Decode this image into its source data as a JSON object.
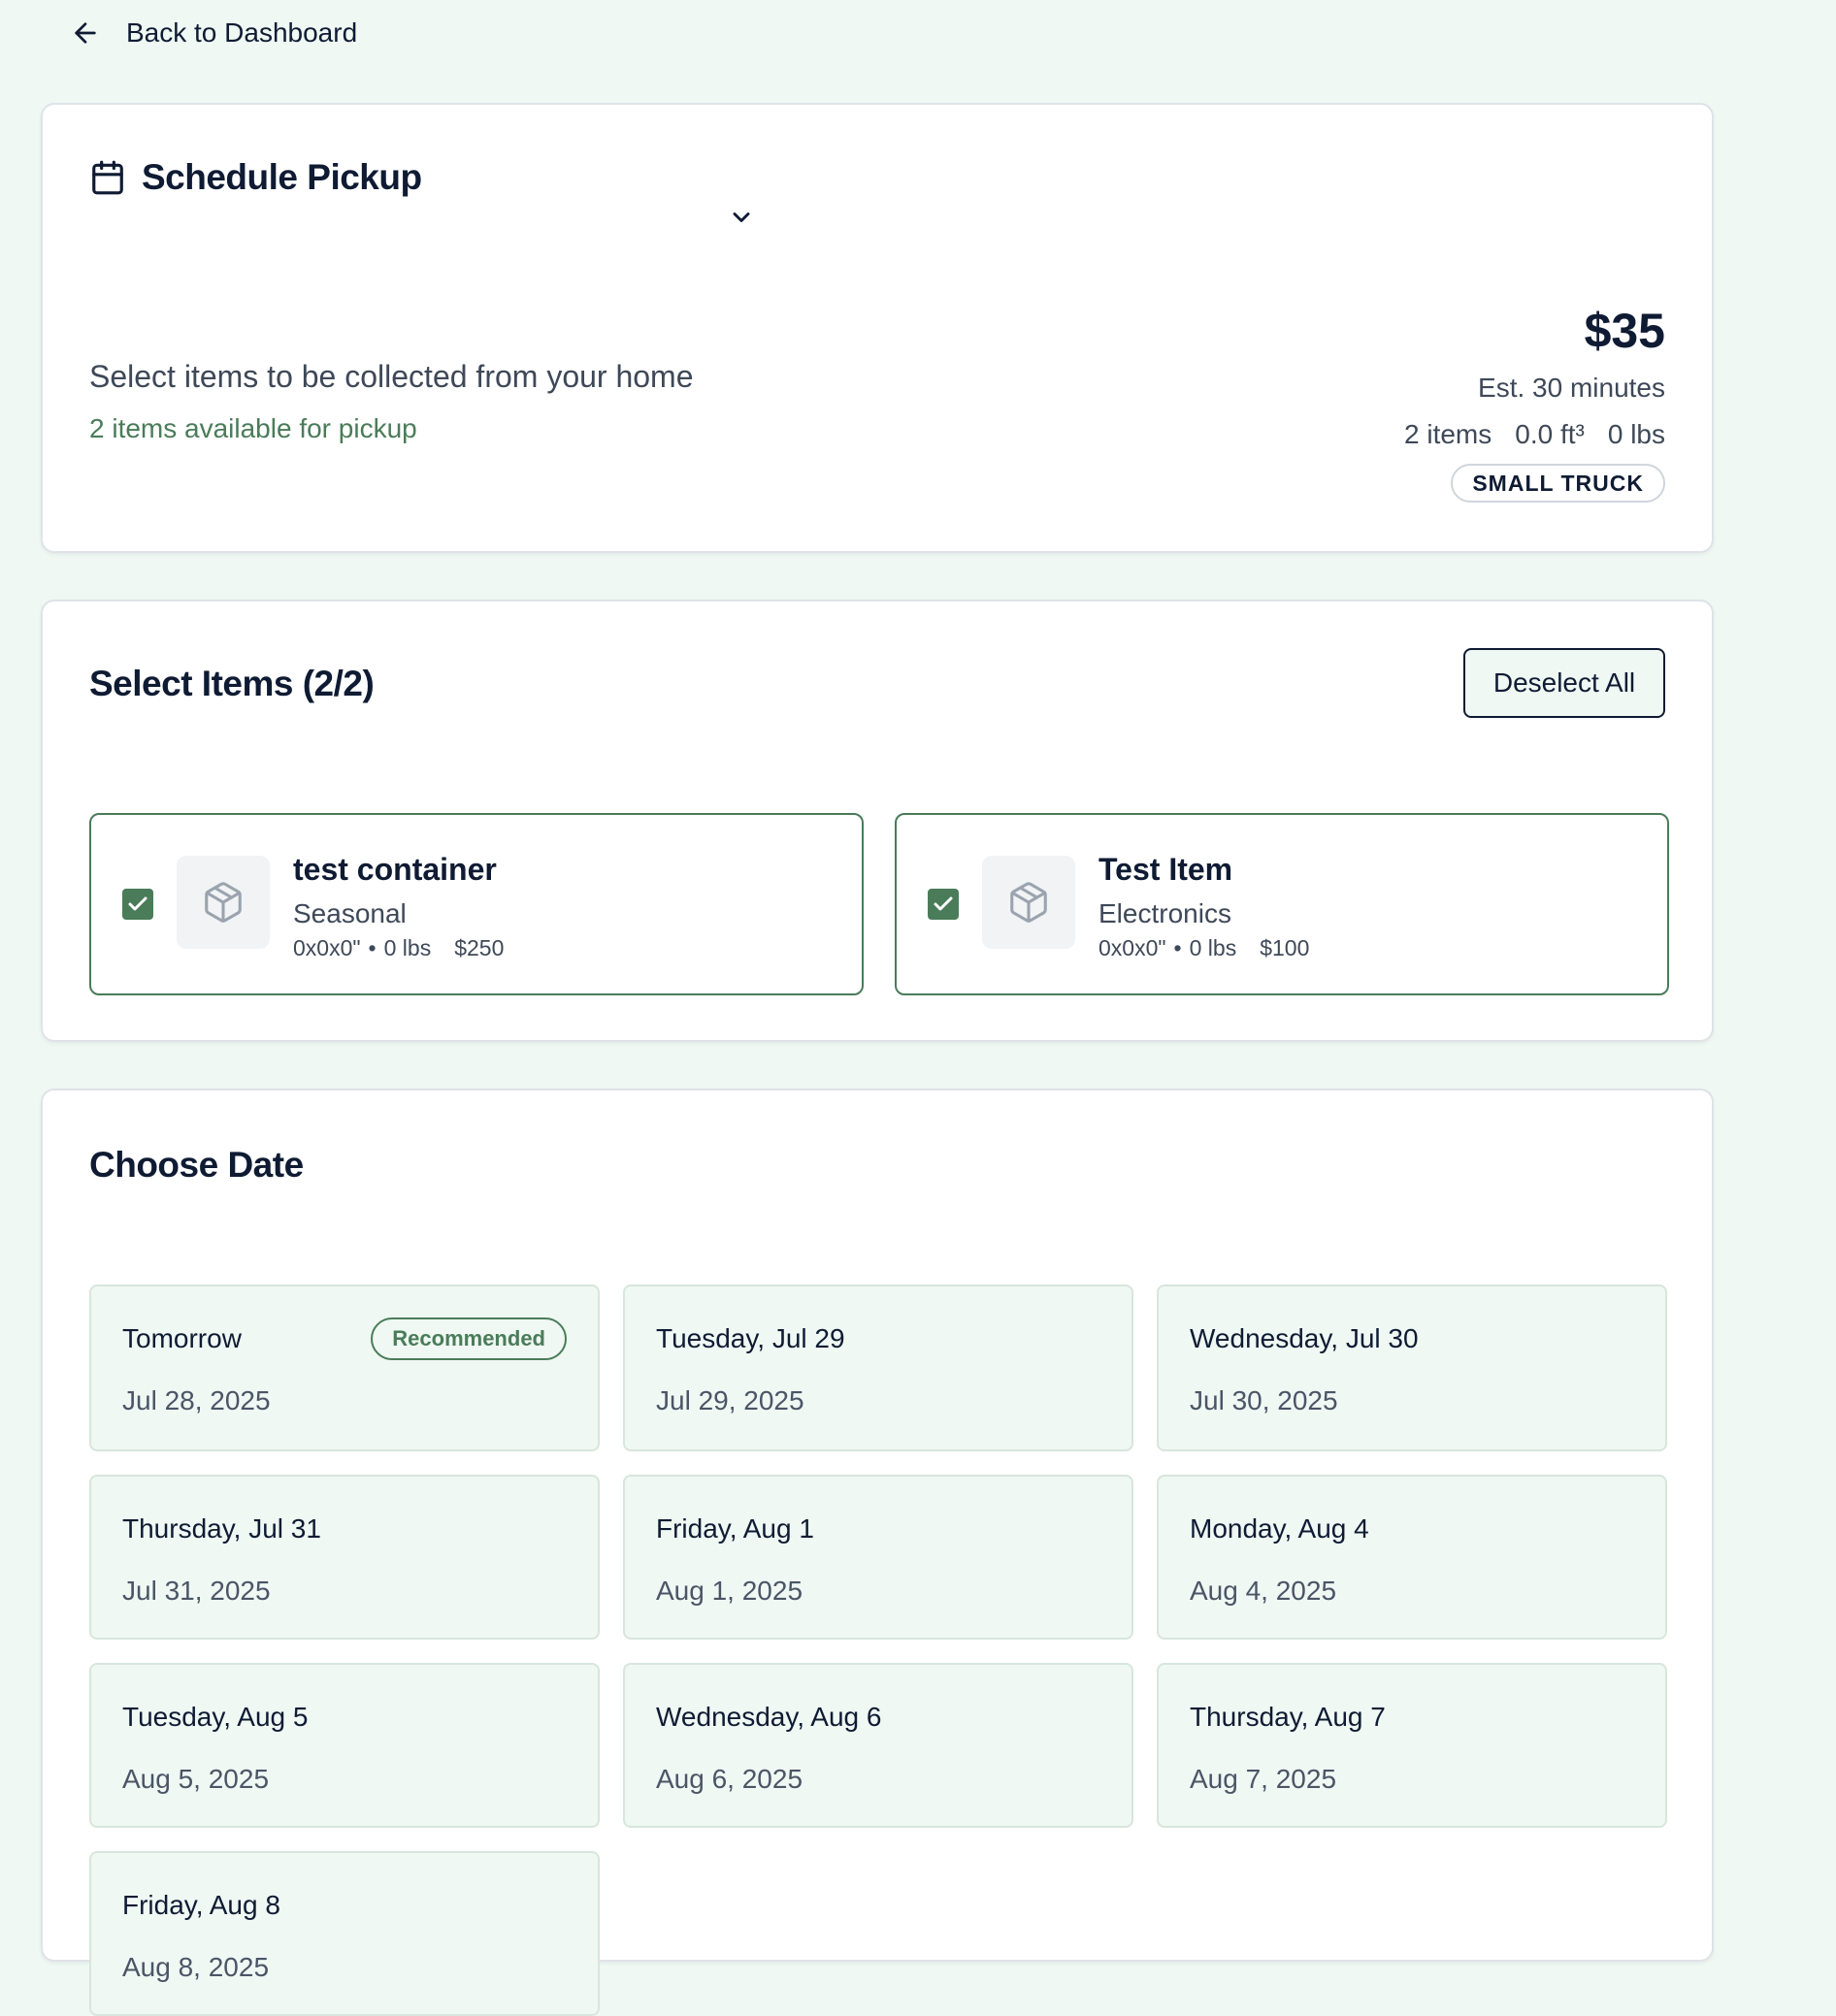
{
  "back": {
    "label": "Back to Dashboard"
  },
  "schedule": {
    "title": "Schedule Pickup",
    "description": "Select items to be collected from your home",
    "available": "2 items available for pickup",
    "price": "$35",
    "estimate": "Est. 30 minutes",
    "stats": {
      "items": "2 items",
      "volume": "0.0 ft³",
      "weight": "0 lbs"
    },
    "vehicle": "SMALL TRUCK"
  },
  "items_section": {
    "title": "Select Items (2/2)",
    "deselect_label": "Deselect All",
    "items": [
      {
        "name": "test container",
        "category": "Seasonal",
        "dimensions": "0x0x0\"",
        "separator": "•",
        "weight": "0 lbs",
        "value": "$250",
        "checked": true
      },
      {
        "name": "Test Item",
        "category": "Electronics",
        "dimensions": "0x0x0\"",
        "separator": "•",
        "weight": "0 lbs",
        "value": "$100",
        "checked": true
      }
    ]
  },
  "dates_section": {
    "title": "Choose Date",
    "recommended_label": "Recommended",
    "dates": [
      {
        "day": "Tomorrow",
        "date": "Jul 28, 2025",
        "recommended": true
      },
      {
        "day": "Tuesday, Jul 29",
        "date": "Jul 29, 2025"
      },
      {
        "day": "Wednesday, Jul 30",
        "date": "Jul 30, 2025"
      },
      {
        "day": "Thursday, Jul 31",
        "date": "Jul 31, 2025"
      },
      {
        "day": "Friday, Aug 1",
        "date": "Aug 1, 2025"
      },
      {
        "day": "Monday, Aug 4",
        "date": "Aug 4, 2025"
      },
      {
        "day": "Tuesday, Aug 5",
        "date": "Aug 5, 2025"
      },
      {
        "day": "Wednesday, Aug 6",
        "date": "Aug 6, 2025"
      },
      {
        "day": "Thursday, Aug 7",
        "date": "Aug 7, 2025"
      },
      {
        "day": "Friday, Aug 8",
        "date": "Aug 8, 2025"
      }
    ]
  },
  "colors": {
    "background": "#eff8f3",
    "accent": "#4a7c59",
    "text": "#0f1b33",
    "muted": "#3e4858"
  },
  "icons": {
    "back": "arrow-left-icon",
    "calendar": "calendar-icon",
    "chevron": "chevron-down-icon",
    "box": "package-icon",
    "check": "check-icon"
  }
}
